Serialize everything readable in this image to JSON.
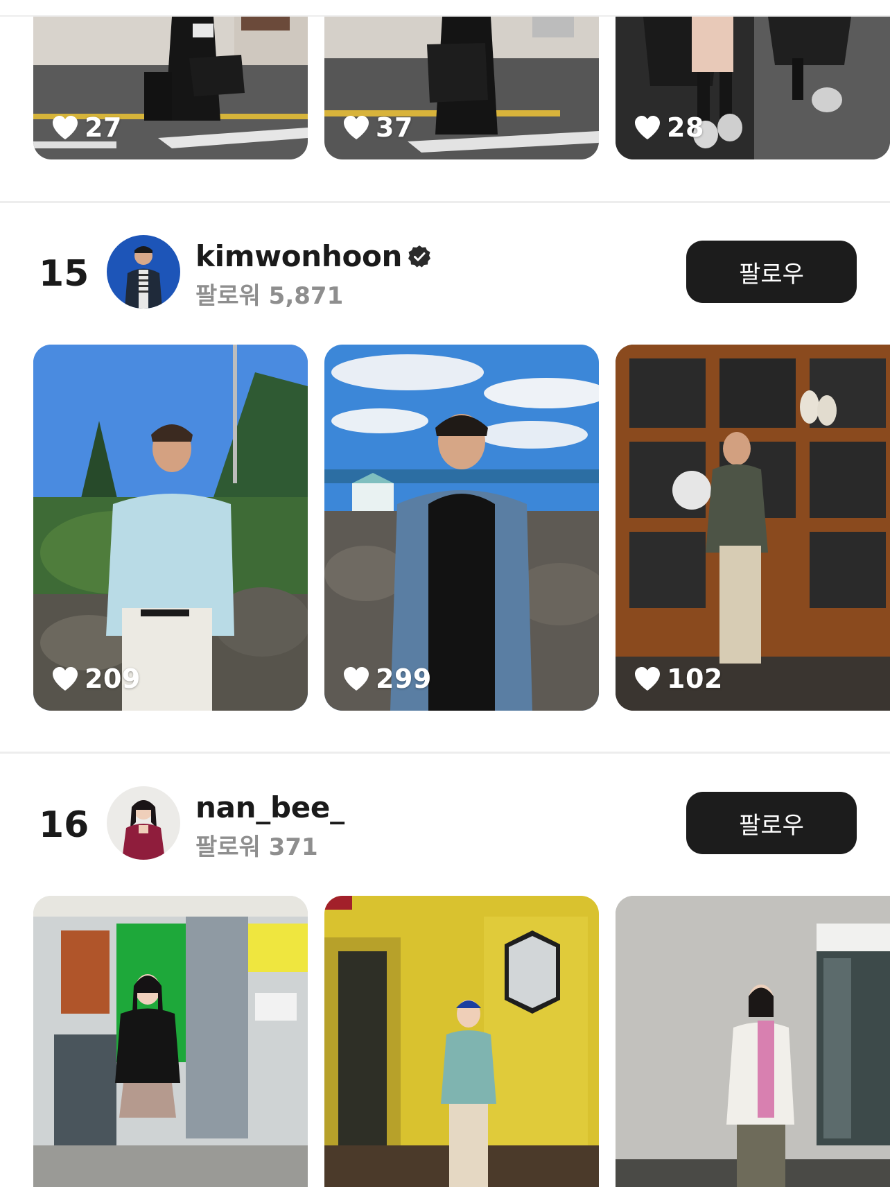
{
  "top_row": {
    "posts": [
      {
        "likes": "27"
      },
      {
        "likes": "37"
      },
      {
        "likes": "28"
      }
    ]
  },
  "rankers": [
    {
      "rank": "15",
      "username": "kimwonhoon",
      "verified": true,
      "followers_label": "팔로워 5,871",
      "follow_label": "팔로우",
      "posts": [
        {
          "likes": "209"
        },
        {
          "likes": "299"
        },
        {
          "likes": "102"
        }
      ]
    },
    {
      "rank": "16",
      "username": "nan_bee_",
      "verified": false,
      "followers_label": "팔로워 371",
      "follow_label": "팔로우",
      "posts": [
        {
          "likes": ""
        },
        {
          "likes": ""
        },
        {
          "likes": ""
        }
      ]
    }
  ],
  "icons": {
    "like": "heart-icon",
    "verified": "verified-badge-icon"
  },
  "colors": {
    "follow_button": "#1c1c1c",
    "follower_text": "#8e8e8e",
    "divider": "#ededed"
  }
}
